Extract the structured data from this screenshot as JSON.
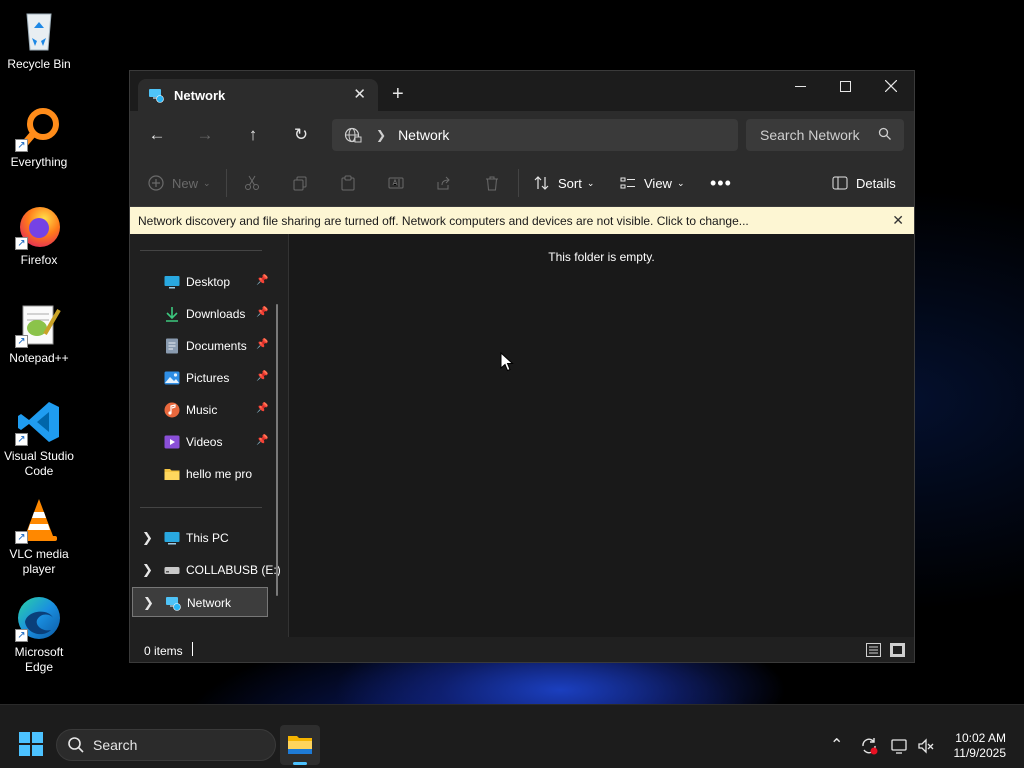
{
  "desktop": {
    "icons": [
      {
        "label": "Recycle Bin"
      },
      {
        "label": "Everything"
      },
      {
        "label": "Firefox"
      },
      {
        "label": "Notepad++"
      },
      {
        "label": "Visual Studio Code"
      },
      {
        "label": "VLC media player"
      },
      {
        "label": "Microsoft Edge"
      }
    ]
  },
  "window": {
    "tab_title": "Network",
    "nav": {
      "address_path": "Network",
      "search_placeholder": "Search Network"
    },
    "toolbar": {
      "new_label": "New",
      "sort_label": "Sort",
      "view_label": "View",
      "details_label": "Details"
    },
    "infobar": {
      "message": "Network discovery and file sharing are turned off. Network computers and devices are not visible. Click to change..."
    },
    "sidebar": {
      "quick_access": [
        {
          "label": "Desktop",
          "icon": "desktop-icon",
          "pinned": true
        },
        {
          "label": "Downloads",
          "icon": "download-icon",
          "pinned": true
        },
        {
          "label": "Documents",
          "icon": "document-icon",
          "pinned": true
        },
        {
          "label": "Pictures",
          "icon": "pictures-icon",
          "pinned": true
        },
        {
          "label": "Music",
          "icon": "music-icon",
          "pinned": true
        },
        {
          "label": "Videos",
          "icon": "videos-icon",
          "pinned": true
        },
        {
          "label": "hello me pro",
          "icon": "folder-icon",
          "pinned": false
        }
      ],
      "locations": [
        {
          "label": "This PC",
          "icon": "computer-icon"
        },
        {
          "label": "COLLABUSB (E:)",
          "icon": "usb-drive-icon"
        },
        {
          "label": "Network",
          "icon": "network-icon",
          "selected": true
        }
      ]
    },
    "content": {
      "empty_message": "This folder is empty."
    },
    "status": {
      "item_count": "0 items"
    }
  },
  "taskbar": {
    "search_label": "Search",
    "time": "10:02 AM",
    "date": "11/9/2025"
  },
  "colors": {
    "accent": "#4cc2ff",
    "infobar_bg": "#fdf6d3",
    "window_bg": "#202020"
  }
}
